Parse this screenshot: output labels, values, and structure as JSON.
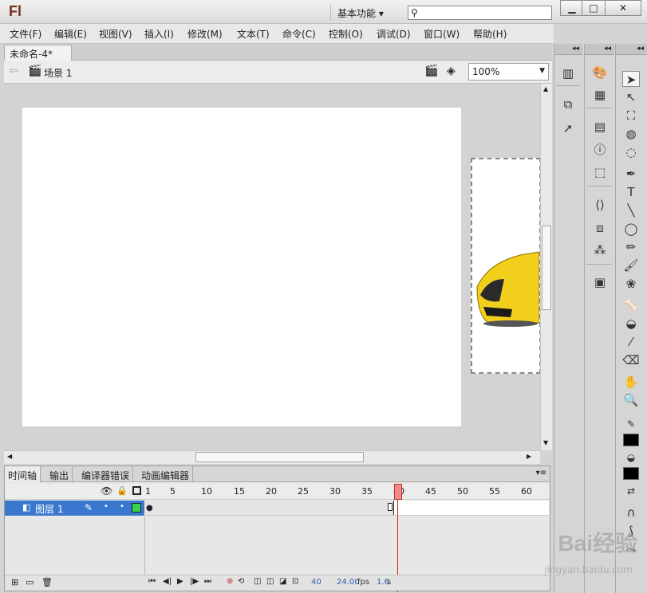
{
  "app": {
    "logo": "Fl",
    "workspace": "基本功能 ▾",
    "search_placeholder": ""
  },
  "window_buttons": [
    "▁",
    "□",
    "✕"
  ],
  "menu": [
    "文件(F)",
    "编辑(E)",
    "视图(V)",
    "插入(I)",
    "修改(M)",
    "文本(T)",
    "命令(C)",
    "控制(O)",
    "调试(D)",
    "窗口(W)",
    "帮助(H)"
  ],
  "document": {
    "tab": "未命名-4*",
    "close": "×",
    "scene": "场景 1",
    "zoom": "100%"
  },
  "timeline": {
    "tabs": [
      "时间轴",
      "输出",
      "编译器错误",
      "动画编辑器"
    ],
    "frame_numbers": [
      "1",
      "5",
      "10",
      "15",
      "20",
      "25",
      "30",
      "35",
      "40",
      "45",
      "50",
      "55",
      "60"
    ],
    "layer_name": "图层 1",
    "playhead_frame": 40,
    "status": {
      "frame": "40",
      "fps": "24.00",
      "fps_unit": "fps",
      "time": "1.6",
      "time_unit": "s"
    }
  },
  "watermark": {
    "brand": "Bai经验",
    "url": "jingyan.baidu.com"
  }
}
